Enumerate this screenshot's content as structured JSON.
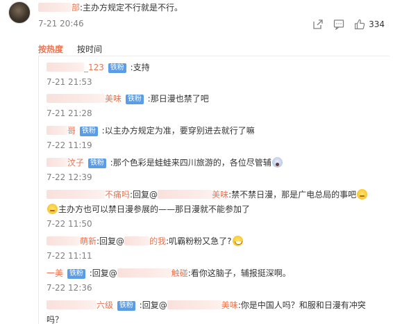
{
  "post": {
    "user_tail": "部",
    "text": ":主办方规定不行就是不行。",
    "time": "7-21 20:46",
    "like_count": "334",
    "icons": [
      "share-icon",
      "comment-icon",
      "like-icon"
    ]
  },
  "sort": {
    "by_hot": "按热度",
    "by_time": "按时间"
  },
  "replies": [
    {
      "user_tail": "_123",
      "badge": "铁粉",
      "text": ":支持",
      "time": "7-21 21:53"
    },
    {
      "user_tail": "美味",
      "badge": "铁粉",
      "text": ":那日漫也禁了吧",
      "time": "7-21 21:28"
    },
    {
      "user_tail": "哥",
      "badge": "铁粉",
      "text": ":以主办方规定为准，要穿别进去就行了嘛",
      "time": "7-22 11:19"
    },
    {
      "user_tail": "汶子",
      "badge": "铁粉",
      "text": ":那个色彩是蛙蛙来四川旅游的，各位尽管辅",
      "time": "7-22 12:39"
    },
    {
      "user_tail": "不痛吗",
      "text_a": ":回复@",
      "mention_tail": "美味",
      "text_b": ":禁不禁日漫，那是广电总局的事吧",
      "text_c": "主办方也可以禁日漫参展的——那日漫就不能参加了",
      "time": "7-22 11:50"
    },
    {
      "user_tail": "萌新",
      "text_a": ":回复@",
      "mention_tail": "的我",
      "text_b": ":叽霸粉粉又急了?",
      "time": "7-22 11:11"
    },
    {
      "user_head": "一",
      "user_tail": "美",
      "badge": "铁粉",
      "text_a": ":回复@",
      "mention_tail": "触碰",
      "text_b": ":看你这脑子，辅报挺深啊。",
      "time": "7-22 12:36"
    },
    {
      "user_tail": "六级",
      "badge": "铁粉",
      "text_a": ":回复@",
      "mention_tail": "美味",
      "text_b": ":你是中国人吗？和服和日漫有冲突",
      "text_c": "吗？"
    }
  ],
  "colors": {
    "accent": "#eb7350",
    "badge": "#5a9de6",
    "muted": "#808080",
    "text": "#333333"
  }
}
